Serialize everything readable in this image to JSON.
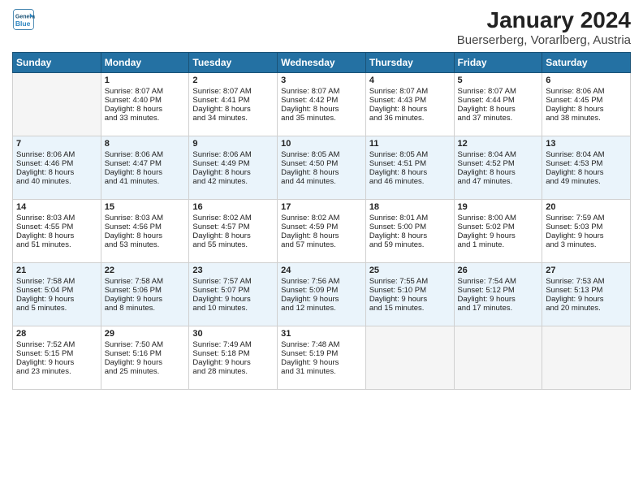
{
  "logo": {
    "line1": "General",
    "line2": "Blue"
  },
  "title": "January 2024",
  "subtitle": "Buerserberg, Vorarlberg, Austria",
  "days_header": [
    "Sunday",
    "Monday",
    "Tuesday",
    "Wednesday",
    "Thursday",
    "Friday",
    "Saturday"
  ],
  "weeks": [
    [
      {
        "day": "",
        "content": ""
      },
      {
        "day": "1",
        "content": "Sunrise: 8:07 AM\nSunset: 4:40 PM\nDaylight: 8 hours\nand 33 minutes."
      },
      {
        "day": "2",
        "content": "Sunrise: 8:07 AM\nSunset: 4:41 PM\nDaylight: 8 hours\nand 34 minutes."
      },
      {
        "day": "3",
        "content": "Sunrise: 8:07 AM\nSunset: 4:42 PM\nDaylight: 8 hours\nand 35 minutes."
      },
      {
        "day": "4",
        "content": "Sunrise: 8:07 AM\nSunset: 4:43 PM\nDaylight: 8 hours\nand 36 minutes."
      },
      {
        "day": "5",
        "content": "Sunrise: 8:07 AM\nSunset: 4:44 PM\nDaylight: 8 hours\nand 37 minutes."
      },
      {
        "day": "6",
        "content": "Sunrise: 8:06 AM\nSunset: 4:45 PM\nDaylight: 8 hours\nand 38 minutes."
      }
    ],
    [
      {
        "day": "7",
        "content": "Sunrise: 8:06 AM\nSunset: 4:46 PM\nDaylight: 8 hours\nand 40 minutes."
      },
      {
        "day": "8",
        "content": "Sunrise: 8:06 AM\nSunset: 4:47 PM\nDaylight: 8 hours\nand 41 minutes."
      },
      {
        "day": "9",
        "content": "Sunrise: 8:06 AM\nSunset: 4:49 PM\nDaylight: 8 hours\nand 42 minutes."
      },
      {
        "day": "10",
        "content": "Sunrise: 8:05 AM\nSunset: 4:50 PM\nDaylight: 8 hours\nand 44 minutes."
      },
      {
        "day": "11",
        "content": "Sunrise: 8:05 AM\nSunset: 4:51 PM\nDaylight: 8 hours\nand 46 minutes."
      },
      {
        "day": "12",
        "content": "Sunrise: 8:04 AM\nSunset: 4:52 PM\nDaylight: 8 hours\nand 47 minutes."
      },
      {
        "day": "13",
        "content": "Sunrise: 8:04 AM\nSunset: 4:53 PM\nDaylight: 8 hours\nand 49 minutes."
      }
    ],
    [
      {
        "day": "14",
        "content": "Sunrise: 8:03 AM\nSunset: 4:55 PM\nDaylight: 8 hours\nand 51 minutes."
      },
      {
        "day": "15",
        "content": "Sunrise: 8:03 AM\nSunset: 4:56 PM\nDaylight: 8 hours\nand 53 minutes."
      },
      {
        "day": "16",
        "content": "Sunrise: 8:02 AM\nSunset: 4:57 PM\nDaylight: 8 hours\nand 55 minutes."
      },
      {
        "day": "17",
        "content": "Sunrise: 8:02 AM\nSunset: 4:59 PM\nDaylight: 8 hours\nand 57 minutes."
      },
      {
        "day": "18",
        "content": "Sunrise: 8:01 AM\nSunset: 5:00 PM\nDaylight: 8 hours\nand 59 minutes."
      },
      {
        "day": "19",
        "content": "Sunrise: 8:00 AM\nSunset: 5:02 PM\nDaylight: 9 hours\nand 1 minute."
      },
      {
        "day": "20",
        "content": "Sunrise: 7:59 AM\nSunset: 5:03 PM\nDaylight: 9 hours\nand 3 minutes."
      }
    ],
    [
      {
        "day": "21",
        "content": "Sunrise: 7:58 AM\nSunset: 5:04 PM\nDaylight: 9 hours\nand 5 minutes."
      },
      {
        "day": "22",
        "content": "Sunrise: 7:58 AM\nSunset: 5:06 PM\nDaylight: 9 hours\nand 8 minutes."
      },
      {
        "day": "23",
        "content": "Sunrise: 7:57 AM\nSunset: 5:07 PM\nDaylight: 9 hours\nand 10 minutes."
      },
      {
        "day": "24",
        "content": "Sunrise: 7:56 AM\nSunset: 5:09 PM\nDaylight: 9 hours\nand 12 minutes."
      },
      {
        "day": "25",
        "content": "Sunrise: 7:55 AM\nSunset: 5:10 PM\nDaylight: 9 hours\nand 15 minutes."
      },
      {
        "day": "26",
        "content": "Sunrise: 7:54 AM\nSunset: 5:12 PM\nDaylight: 9 hours\nand 17 minutes."
      },
      {
        "day": "27",
        "content": "Sunrise: 7:53 AM\nSunset: 5:13 PM\nDaylight: 9 hours\nand 20 minutes."
      }
    ],
    [
      {
        "day": "28",
        "content": "Sunrise: 7:52 AM\nSunset: 5:15 PM\nDaylight: 9 hours\nand 23 minutes."
      },
      {
        "day": "29",
        "content": "Sunrise: 7:50 AM\nSunset: 5:16 PM\nDaylight: 9 hours\nand 25 minutes."
      },
      {
        "day": "30",
        "content": "Sunrise: 7:49 AM\nSunset: 5:18 PM\nDaylight: 9 hours\nand 28 minutes."
      },
      {
        "day": "31",
        "content": "Sunrise: 7:48 AM\nSunset: 5:19 PM\nDaylight: 9 hours\nand 31 minutes."
      },
      {
        "day": "",
        "content": ""
      },
      {
        "day": "",
        "content": ""
      },
      {
        "day": "",
        "content": ""
      }
    ]
  ]
}
